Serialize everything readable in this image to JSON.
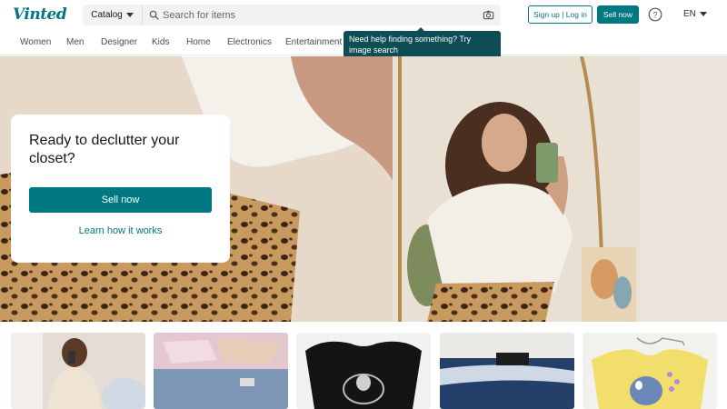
{
  "brand": {
    "logo_text": "Vinted",
    "accent": "#007782"
  },
  "search": {
    "catalog_label": "Catalog",
    "placeholder": "Search for items",
    "value": ""
  },
  "header": {
    "signup_label": "Sign up | Log in",
    "sell_label": "Sell now",
    "language": "EN"
  },
  "nav": {
    "items": [
      "Women",
      "Men",
      "Designer",
      "Kids",
      "Home",
      "Electronics",
      "Entertainment"
    ]
  },
  "tooltip": {
    "text": "Need help finding something? Try image search"
  },
  "hero": {
    "title": "Ready to declutter your closet?",
    "sell_button": "Sell now",
    "learn_link": "Learn how it works"
  },
  "products": [
    {
      "name": "product-photo-cardigan",
      "bg": "#d9cfc2"
    },
    {
      "name": "product-photo-denim-shorts-pink",
      "bg": "#cfd6de"
    },
    {
      "name": "product-photo-black-top",
      "bg": "#e8e8e8"
    },
    {
      "name": "product-photo-denim-shorts-blue",
      "bg": "#2f4f7a"
    },
    {
      "name": "product-photo-yellow-tshirt",
      "bg": "#f3e27a"
    }
  ]
}
